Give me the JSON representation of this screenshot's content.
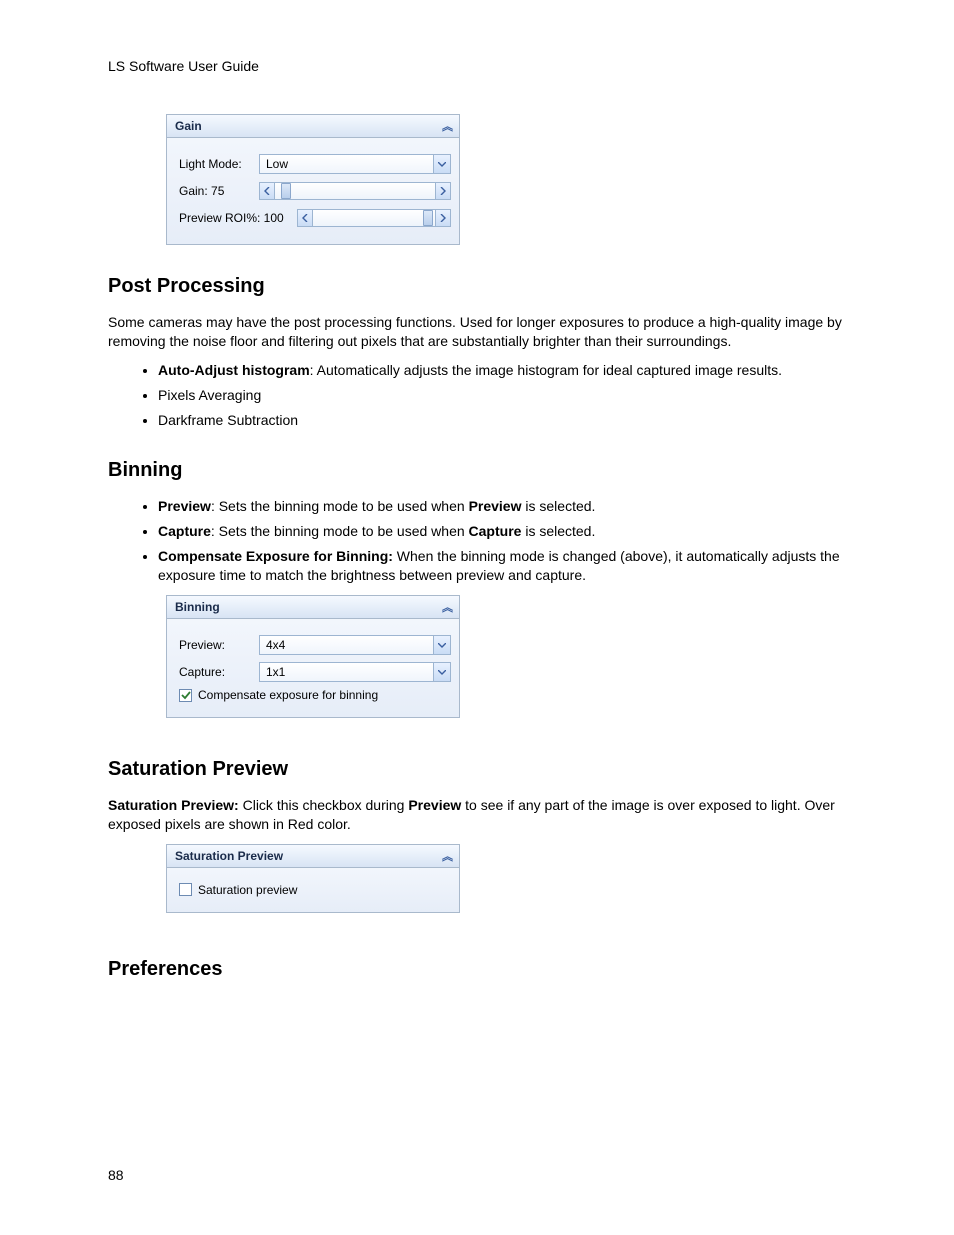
{
  "header": "LS Software User Guide",
  "page_number": "88",
  "gainPanel": {
    "title": "Gain",
    "lightMode": {
      "label": "Light Mode:",
      "value": "Low"
    },
    "gain": {
      "label": "Gain: 75"
    },
    "previewRoi": {
      "label": "Preview ROI%: 100"
    }
  },
  "postProcessing": {
    "heading": "Post Processing",
    "intro": "Some cameras may have the post processing functions. Used for longer exposures to produce a high-quality image by removing the noise floor and filtering out pixels that are substantially brighter than their surroundings.",
    "b1_bold": "Auto-Adjust histogram",
    "b1_rest": ": Automatically adjusts the image histogram for ideal captured image results.",
    "b2": "Pixels Averaging",
    "b3": "Darkframe Subtraction"
  },
  "binning": {
    "heading": "Binning",
    "b1_bold": "Preview",
    "b1_rest": ": Sets the binning mode to be used when ",
    "b1_bold2": "Preview",
    "b1_end": " is selected.",
    "b2_bold": "Capture",
    "b2_rest": ": Sets the binning mode to be used when ",
    "b2_bold2": "Capture",
    "b2_end": " is selected.",
    "b3_bold": "Compensate Exposure for Binning:",
    "b3_rest": " When the binning mode is changed (above), it automatically adjusts the exposure time to match the brightness between preview and capture.",
    "panel": {
      "title": "Binning",
      "preview": {
        "label": "Preview:",
        "value": "4x4"
      },
      "capture": {
        "label": "Capture:",
        "value": "1x1"
      },
      "checkbox": {
        "label": "Compensate exposure for binning",
        "checked": true
      }
    }
  },
  "saturation": {
    "heading": "Saturation Preview",
    "para_bold": "Saturation Preview:",
    "para_rest1": " Click this checkbox during ",
    "para_bold2": "Preview",
    "para_rest2": " to see if any part of the image is over exposed to light. Over exposed pixels are shown in Red color.",
    "panel": {
      "title": "Saturation Preview",
      "checkbox": {
        "label": "Saturation preview",
        "checked": false
      }
    }
  },
  "preferences": {
    "heading": "Preferences"
  }
}
